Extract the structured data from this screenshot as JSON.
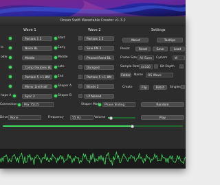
{
  "window": {
    "title": "Ocean Swift Wavetable Creator v1.3.2"
  },
  "wave1": {
    "header": "Wave 1",
    "rows": [
      {
        "left": "",
        "button": "Partials 1 5"
      },
      {
        "left": "le",
        "button": "Noise 8L"
      },
      {
        "left": "odle",
        "button": "Middle"
      },
      {
        "left": "",
        "button": "Comp Doubles 8L"
      },
      {
        "left": "",
        "button": "Partials 5 >1 8M"
      },
      {
        "left": "",
        "button": "Mirror 2nd Half"
      },
      {
        "left": "hape A",
        "button": "Sync 2"
      }
    ]
  },
  "mid": {
    "rows": [
      {
        "label": "Start",
        "dot": true
      },
      {
        "label": "Early",
        "dot": true
      },
      {
        "label": "Middle",
        "dot": true
      },
      {
        "label": "Late",
        "dot": true
      },
      {
        "label": "End",
        "dot": true
      },
      {
        "label": "Shaper A",
        "dot": true
      },
      {
        "label": "Shaper B",
        "dot": true
      }
    ]
  },
  "wave2": {
    "header": "Wave 2",
    "rows": [
      {
        "button": "Partials 1 5"
      },
      {
        "button": "Sine FM 2"
      },
      {
        "button": "Phased Rand BL"
      },
      {
        "button": "Damped"
      },
      {
        "button": "Partials 5 >1 8M"
      },
      {
        "button": "Blinds 2"
      },
      {
        "button": "LP Noised"
      }
    ]
  },
  "settings": {
    "header": "Settings",
    "about": "About",
    "tooltips": "Tooltips",
    "preset_label": "Preset",
    "reset": "Reset",
    "save": "Save",
    "load": "Load",
    "frame_size_label": "Frame Size",
    "frame_size_value": "All Sizes",
    "cyclem_label": "Cyclem",
    "cyclem_value": "W",
    "sample_rate_label": "Sample Rate",
    "sample_rate_value": "44100",
    "bit_depth_label": "Bit Depth",
    "folder_label": "Folder",
    "name_label": "Name",
    "name_value": "OS Wave",
    "create": "Create",
    "flip": "Flip",
    "batch": "Batch",
    "singles": "Singles"
  },
  "bottom": {
    "connection_label": "Connection",
    "connection_value": "Mix 75/25",
    "shaper_mode_label": "Shaper Mode",
    "shaper_mode_value": "Phase Sliding",
    "random": "Random",
    "driver_label": "Driver",
    "driver_value": "None",
    "frequency_label": "Frequency",
    "frequency_value": "55 Hz",
    "volume_label": "Volume",
    "play": "Play",
    "volume_level": 0.1,
    "position_level": 0.72
  },
  "colors": {
    "accent": "#3ee05e",
    "window": "#2c2c2c",
    "scope_bg": "#1a1a1a"
  }
}
